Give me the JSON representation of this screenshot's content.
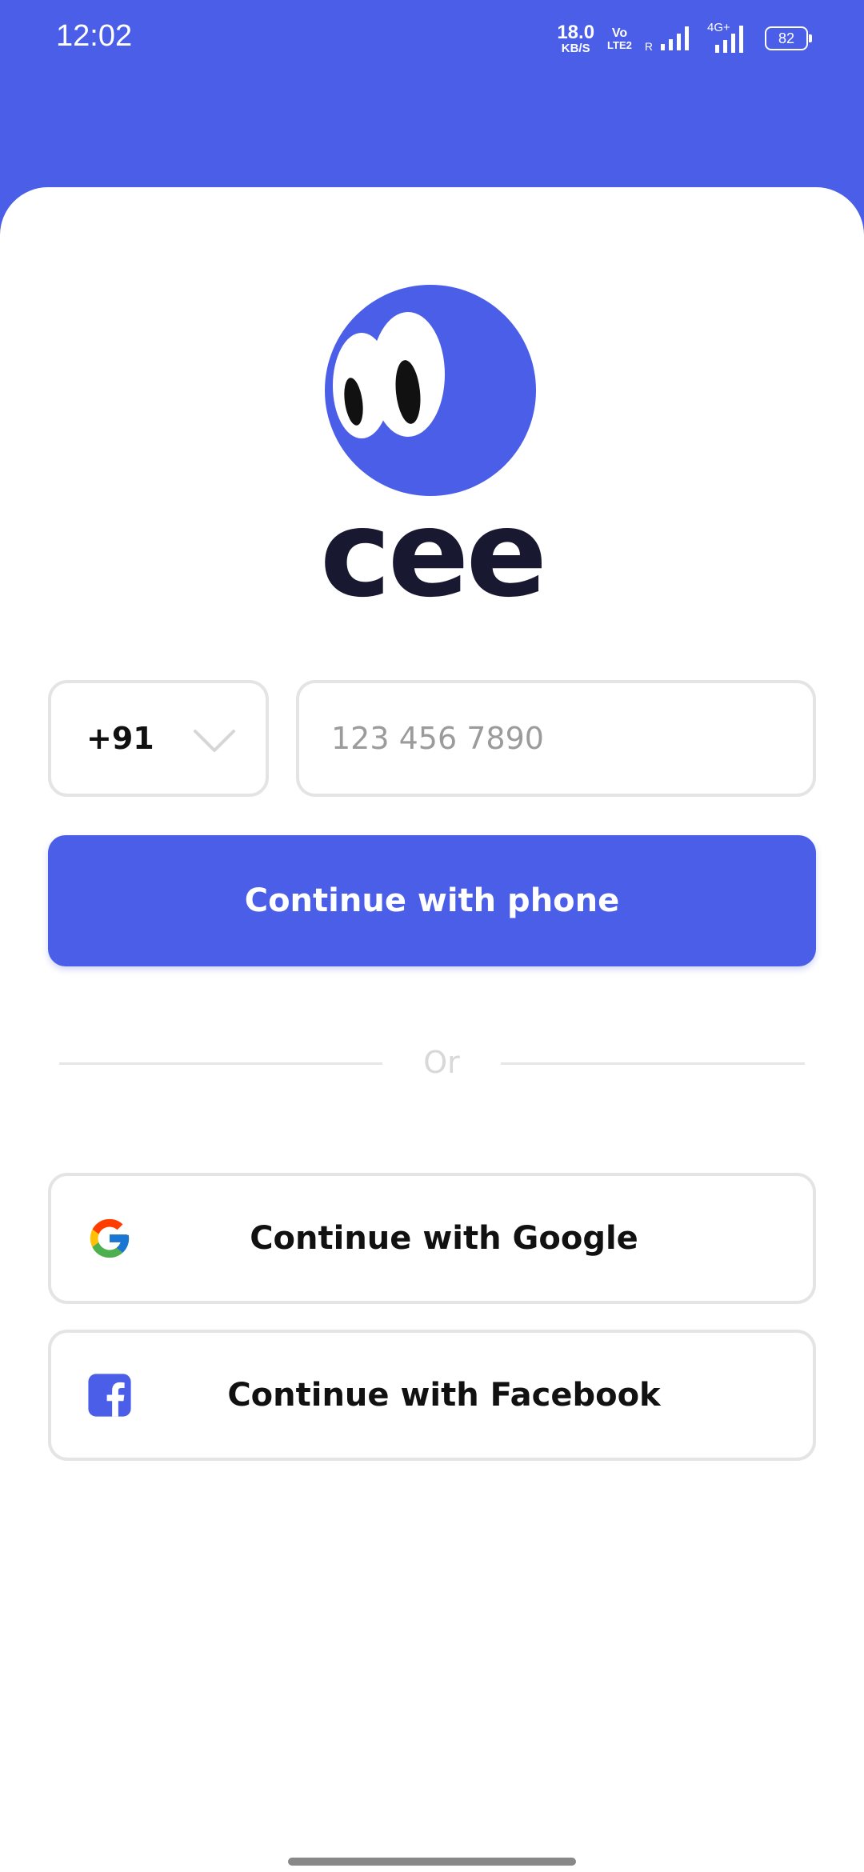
{
  "status_bar": {
    "time": "12:02",
    "net_speed_value": "18.0",
    "net_speed_unit": "KB/S",
    "volte_top": "Vo",
    "volte_bottom": "LTE2",
    "roaming": "R",
    "network_type": "4G+",
    "battery_level": "82"
  },
  "app": {
    "name": "cee",
    "brand_color": "#4a5ee8"
  },
  "login": {
    "country_code": "+91",
    "phone_placeholder": "123 456 7890",
    "phone_value": "",
    "continue_phone_label": "Continue with phone",
    "divider_text": "Or",
    "google_label": "Continue with Google",
    "facebook_label": "Continue with Facebook"
  },
  "icons": {
    "dropdown": "chevron-down-icon",
    "google": "google-icon",
    "facebook": "facebook-icon",
    "logo": "eyes-logo"
  }
}
